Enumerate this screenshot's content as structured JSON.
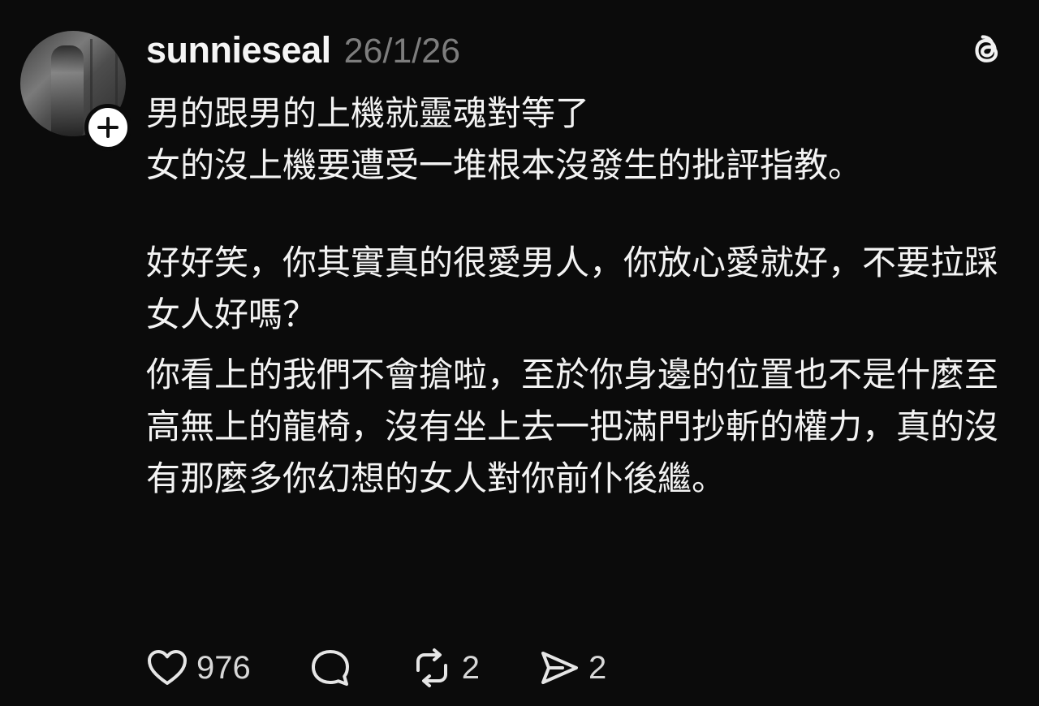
{
  "author": {
    "username": "sunnieseal",
    "timestamp": "26/1/26"
  },
  "icons": {
    "brand": "threads-logo-icon",
    "follow": "plus-icon",
    "like": "heart-icon",
    "comment": "comment-bubble-icon",
    "repost": "repost-icon",
    "share": "send-icon"
  },
  "post": {
    "paragraph_1_line_1": "男的跟男的上機就靈魂對等了",
    "paragraph_1_line_2": "女的沒上機要遭受一堆根本沒發生的批評指教。",
    "paragraph_2": "好好笑，你其實真的很愛男人，你放心愛就好，不要拉踩女人好嗎？",
    "paragraph_3": "你看上的我們不會搶啦，至於你身邊的位置也不是什麼至高無上的龍椅，沒有坐上去一把滿門抄斬的權力，真的沒有那麼多你幻想的女人對你前仆後繼。"
  },
  "actions": {
    "likes": "976",
    "reposts": "2",
    "shares": "2"
  },
  "colors": {
    "background": "#0b0b0b",
    "text": "#f3f3f3",
    "muted": "#7d7d7d"
  }
}
